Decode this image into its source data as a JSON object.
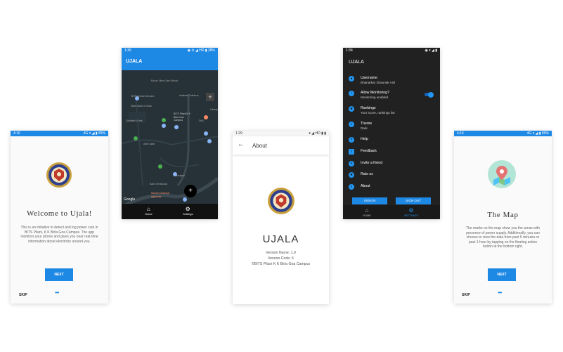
{
  "screens": {
    "welcome": {
      "status_time": "4:16",
      "status_right": "4G ▾ ◢ ▮ 89%",
      "title": "Welcome to Ujala!",
      "body": "This is an initiative to detect and log power cuts in BITS Pilani, K K Birla Goa Campus. The app monitors your phone and gives you near real-time information about electricity around you.",
      "next_label": "NEXT",
      "skip_label": "SKIP",
      "dots": "•••"
    },
    "map": {
      "status_time": "1:36",
      "status_right": "◉ ⊙ ◢ HD ▮ 28%",
      "app_title": "UJALA",
      "labels": {
        "school": "Mount Litera Zee School",
        "cricket": "BITS Cricket Ground",
        "cafe": "Institute Cafeteria",
        "sbi": "State Bank of India",
        "bits": "BITS Pilani K K Birla Goa Campus",
        "library": "Library",
        "childrens": "Children's Park",
        "dh": "DH1",
        "hostel": "Ah8 Cabin",
        "barajoao": "Barajiao",
        "bob": "Bank Of Baroda",
        "medical": "Marine Electrical Agencies",
        "google": "Google"
      },
      "nav_home": "Home",
      "nav_settings": "Settings",
      "fab": "+"
    },
    "about": {
      "status_time": "1:29",
      "status_right": "▾ ◢ HD ▮ ▮",
      "back_arrow": "←",
      "bar_title": "About",
      "app_name": "UJALA",
      "version_name": "Version Name: 1.0",
      "version_code": "Version Code: 6",
      "copyright": "©BITS Pilani K K Birla Goa Campus"
    },
    "settings": {
      "status_time": "1:34",
      "status_right": "◉ ▾ ◢ ▮",
      "app_title": "UJALA",
      "items": [
        {
          "icon": "user-icon",
          "glyph": "●",
          "title": "Username",
          "sub": "Bhanarkar Shaunak Anil"
        },
        {
          "icon": "monitor-icon",
          "glyph": "◔",
          "title": "Allow Monitoring?",
          "sub": "Monitoring enabled"
        },
        {
          "icon": "rankings-icon",
          "glyph": "★",
          "title": "Rankings",
          "sub": "Your score, rankings list"
        },
        {
          "icon": "theme-icon",
          "glyph": "◐",
          "title": "Theme",
          "sub": "Dark"
        },
        {
          "icon": "help-icon",
          "glyph": "?",
          "title": "Help",
          "sub": ""
        },
        {
          "icon": "feedback-icon",
          "glyph": "!",
          "title": "Feedback",
          "sub": ""
        },
        {
          "icon": "share-icon",
          "glyph": "<",
          "title": "Invite a friend",
          "sub": ""
        },
        {
          "icon": "star-icon",
          "glyph": "★",
          "title": "Rate us",
          "sub": ""
        },
        {
          "icon": "info-icon",
          "glyph": "i",
          "title": "About",
          "sub": ""
        }
      ],
      "signin_label": "SIGN IN",
      "signout_label": "SIGN OUT",
      "nav_home": "HOME",
      "nav_settings": "SETTINGS",
      "monitoring_enabled": true
    },
    "themap": {
      "status_time": "4:16",
      "status_right": "4G ▾ ◢ ▮ 89%",
      "title": "The Map",
      "body": "The marks on the map show you the areas with presence of power supply. Additionally, you can choose to view the data from past 5 minutes or past 1 hour by tapping on the floating action button at the bottom right.",
      "next_label": "NEXT",
      "skip_label": "SKIP",
      "dots": "•••"
    }
  },
  "colors": {
    "accent": "#1e88e5",
    "dark_bg": "#212121",
    "map_bg": "#263238",
    "pin_green": "#4caf50",
    "pin_orange": "#ff8a65"
  }
}
